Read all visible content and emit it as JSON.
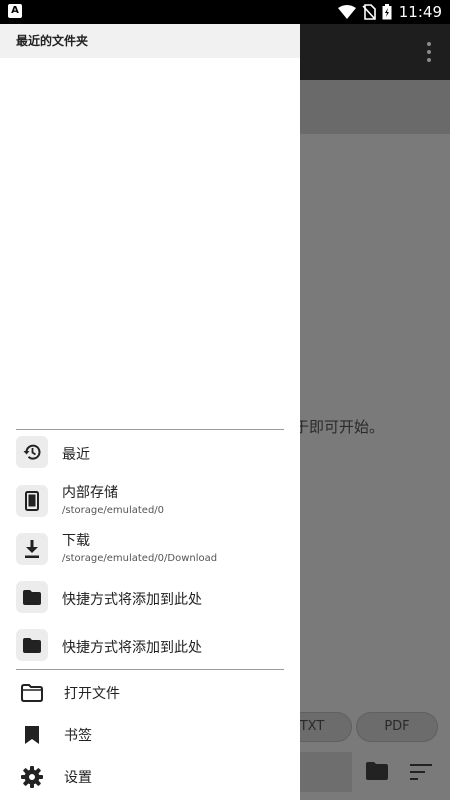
{
  "status_bar": {
    "time": "11:49",
    "notification_icon": "a-letter-icon",
    "icons": [
      "wifi-icon",
      "no-sim-icon",
      "battery-charging-icon"
    ]
  },
  "background": {
    "hint_text": "于即可开始。",
    "format_chips": [
      "TXT",
      "PDF"
    ]
  },
  "drawer": {
    "header": "最近的文件夹",
    "locations": [
      {
        "icon": "history-icon",
        "title": "最近",
        "subtitle": ""
      },
      {
        "icon": "phone-icon",
        "title": "内部存储",
        "subtitle": "/storage/emulated/0"
      },
      {
        "icon": "download-icon",
        "title": "下载",
        "subtitle": "/storage/emulated/0/Download"
      },
      {
        "icon": "folder-icon",
        "title": "快捷方式将添加到此处",
        "subtitle": ""
      },
      {
        "icon": "folder-icon",
        "title": "快捷方式将添加到此处",
        "subtitle": ""
      }
    ],
    "menu": [
      {
        "icon": "folder-open-icon",
        "label": "打开文件"
      },
      {
        "icon": "bookmark-icon",
        "label": "书签"
      },
      {
        "icon": "gear-icon",
        "label": "设置"
      }
    ]
  }
}
